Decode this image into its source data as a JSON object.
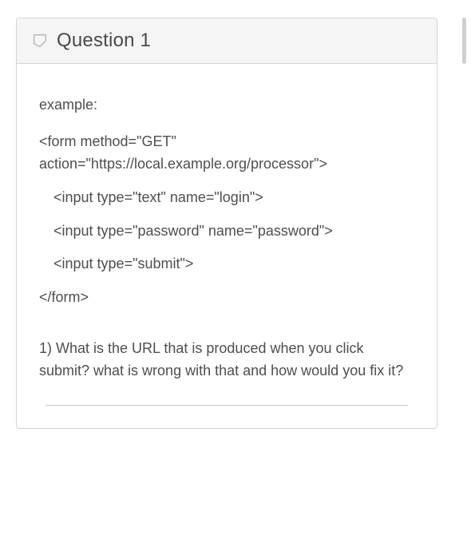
{
  "header": {
    "title": "Question 1"
  },
  "body": {
    "example_label": "example:",
    "code": {
      "line1": "<form method=\"GET\" action=\"https://local.example.org/processor\">",
      "line2": "<input type=\"text\" name=\"login\">",
      "line3": "<input type=\"password\" name=\"password\">",
      "line4": "<input type=\"submit\">",
      "line5": "</form>"
    },
    "question_text": "1) What is the URL that is produced when you click submit? what is wrong with that and how would you fix it?"
  }
}
